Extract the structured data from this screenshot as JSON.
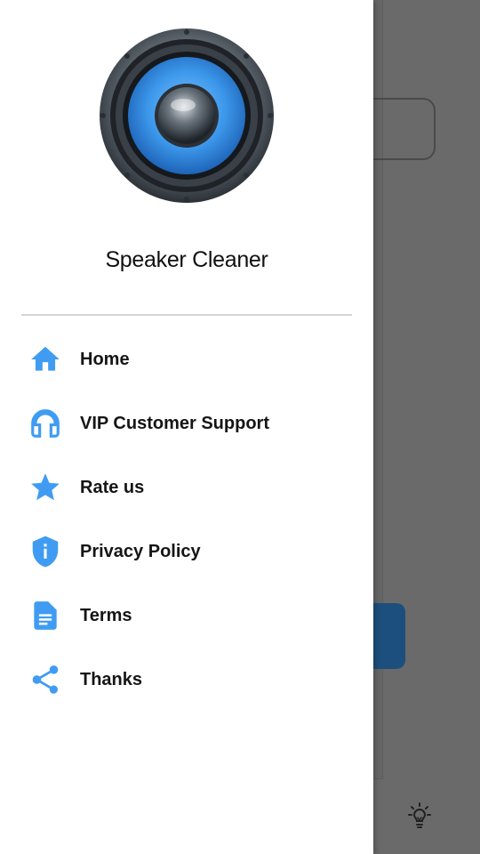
{
  "app": {
    "title": "Speaker Cleaner"
  },
  "drawer": {
    "items": [
      {
        "label": "Home",
        "icon": "home-icon"
      },
      {
        "label": "VIP Customer Support",
        "icon": "headphones-icon"
      },
      {
        "label": "Rate us",
        "icon": "star-icon"
      },
      {
        "label": "Privacy Policy",
        "icon": "shield-info-icon"
      },
      {
        "label": "Terms",
        "icon": "document-icon"
      },
      {
        "label": "Thanks",
        "icon": "share-icon"
      }
    ]
  },
  "colors": {
    "accent": "#3f9cf2",
    "scrim": "#6a6a6a",
    "background_button": "#1c4f7d"
  }
}
